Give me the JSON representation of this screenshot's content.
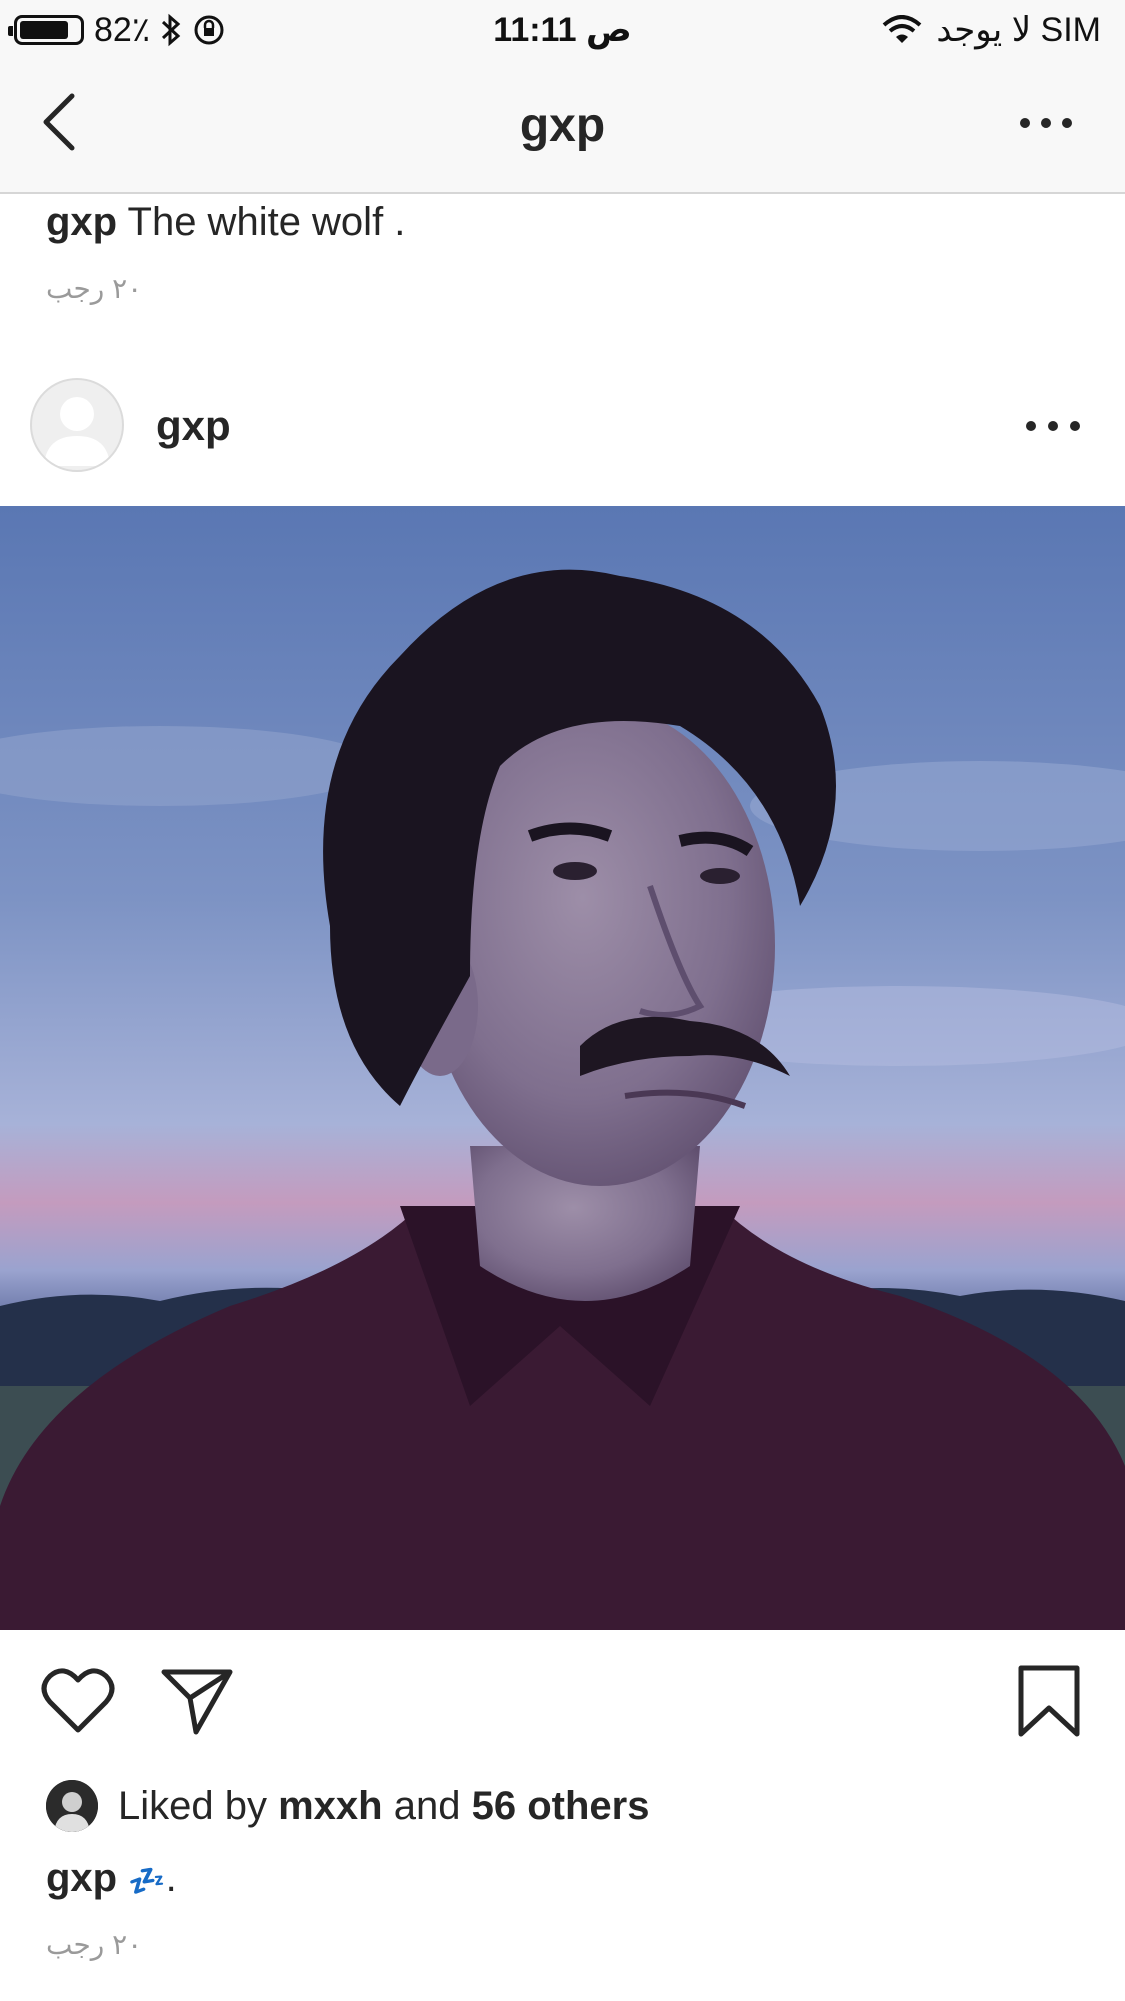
{
  "status_bar": {
    "battery_level": 0.82,
    "battery": "82٪",
    "time": "11:11 ص",
    "carrier": "لا يوجد SIM"
  },
  "nav": {
    "title": "gxp",
    "back_icon": "chevron-left-icon",
    "more_icon": "more-horizontal-icon"
  },
  "previous_post": {
    "username": "gxp",
    "caption": "The white wolf .",
    "date": "٢٠ رجب"
  },
  "post": {
    "username": "gxp",
    "avatar": "default-avatar-icon",
    "more_icon": "more-horizontal-icon",
    "photo": "man-with-mustache-photo",
    "likes": {
      "prefix": "Liked by",
      "user": "mxxh",
      "conjunction": "and",
      "others": "56 others"
    },
    "caption_user": "gxp",
    "caption_emoji": "💤",
    "caption_end": ".",
    "date": "٢٠ رجب"
  },
  "colors": {
    "text": "#262626",
    "meta": "#9a9a9a",
    "bar_bg": "#f8f8f8",
    "accent_zzz": "#1a5fc8"
  }
}
